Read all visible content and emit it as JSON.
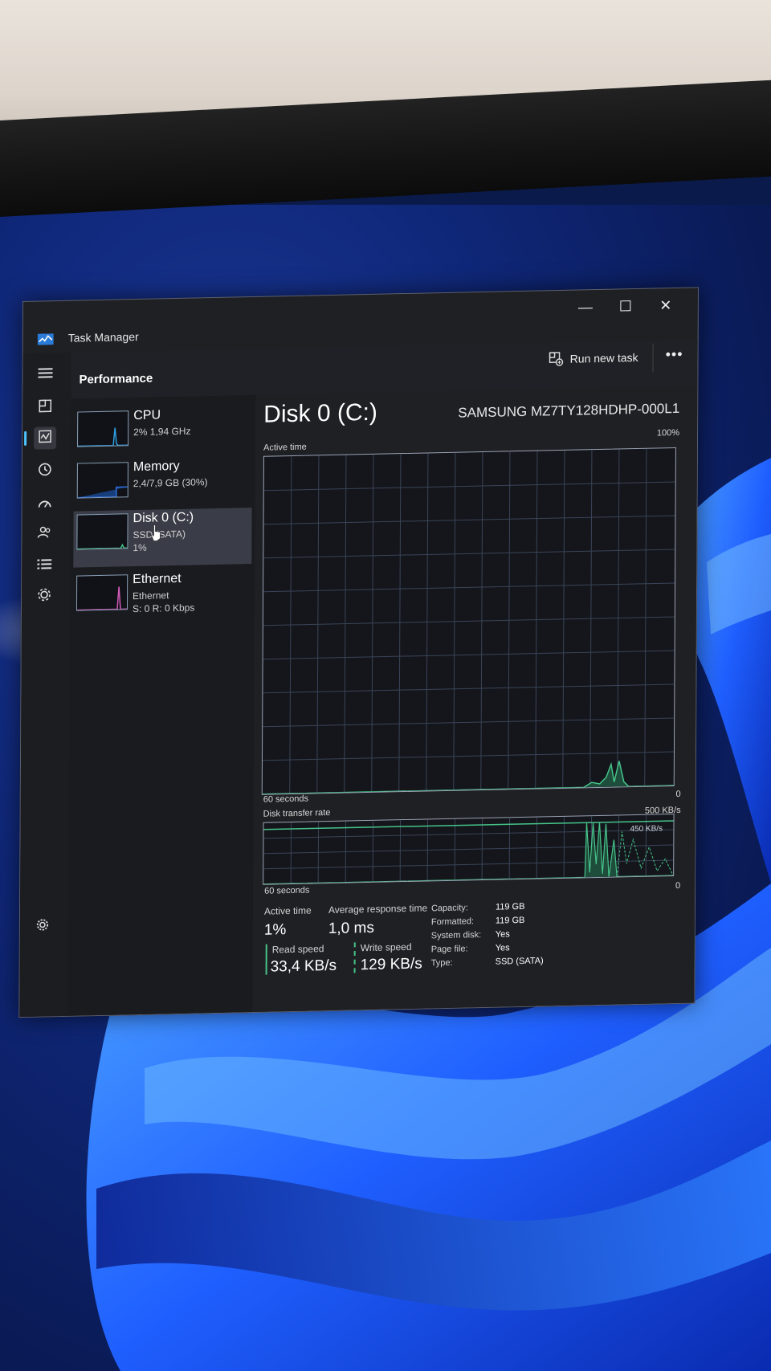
{
  "window": {
    "title": "Task Manager",
    "controls": {
      "minimize": "—",
      "maximize": "☐",
      "close": "✕"
    }
  },
  "nav": {
    "icons": [
      "hamburger-icon",
      "processes-icon",
      "performance-icon",
      "app-history-icon",
      "startup-apps-icon",
      "users-icon",
      "details-icon",
      "services-icon"
    ],
    "settings_icon": "gear-icon",
    "active": "performance"
  },
  "header": {
    "title": "Performance",
    "run_new_task": "Run new task",
    "more": "•••"
  },
  "devices": [
    {
      "name": "CPU",
      "line1": "2% 1,94 GHz",
      "line2": "",
      "accent": "#2f9de0"
    },
    {
      "name": "Memory",
      "line1": "2,4/7,9 GB (30%)",
      "line2": "",
      "accent": "#2f6fe0"
    },
    {
      "name": "Disk 0 (C:)",
      "line1": "SSD (SATA)",
      "line2": "1%",
      "accent": "#46c38a"
    },
    {
      "name": "Ethernet",
      "line1": "Ethernet",
      "line2": "S: 0 R: 0 Kbps",
      "accent": "#d05bb8"
    }
  ],
  "disk": {
    "title": "Disk 0 (C:)",
    "model": "SAMSUNG MZ7TY128HDHP-000L1",
    "active_time_label": "Active time",
    "active_time_max": "100%",
    "axis_left": "60 seconds",
    "axis_right": "0",
    "transfer_label": "Disk transfer rate",
    "transfer_max": "500 KB/s",
    "transfer_mark": "450 KB/s",
    "transfer_axis_left": "60 seconds",
    "transfer_axis_right": "0"
  },
  "stats": {
    "active_time_label": "Active time",
    "active_time_value": "1%",
    "avg_response_label": "Average response time",
    "avg_response_value": "1,0 ms",
    "read_speed_label": "Read speed",
    "read_speed_value": "33,4 KB/s",
    "write_speed_label": "Write speed",
    "write_speed_value": "129 KB/s"
  },
  "properties": [
    {
      "key": "Capacity:",
      "value": "119 GB"
    },
    {
      "key": "Formatted:",
      "value": "119 GB"
    },
    {
      "key": "System disk:",
      "value": "Yes"
    },
    {
      "key": "Page file:",
      "value": "Yes"
    },
    {
      "key": "Type:",
      "value": "SSD (SATA)"
    }
  ],
  "colors": {
    "disk_accent": "#46c38a",
    "read_accent": "#46c38a",
    "write_accent": "#46c38a"
  }
}
